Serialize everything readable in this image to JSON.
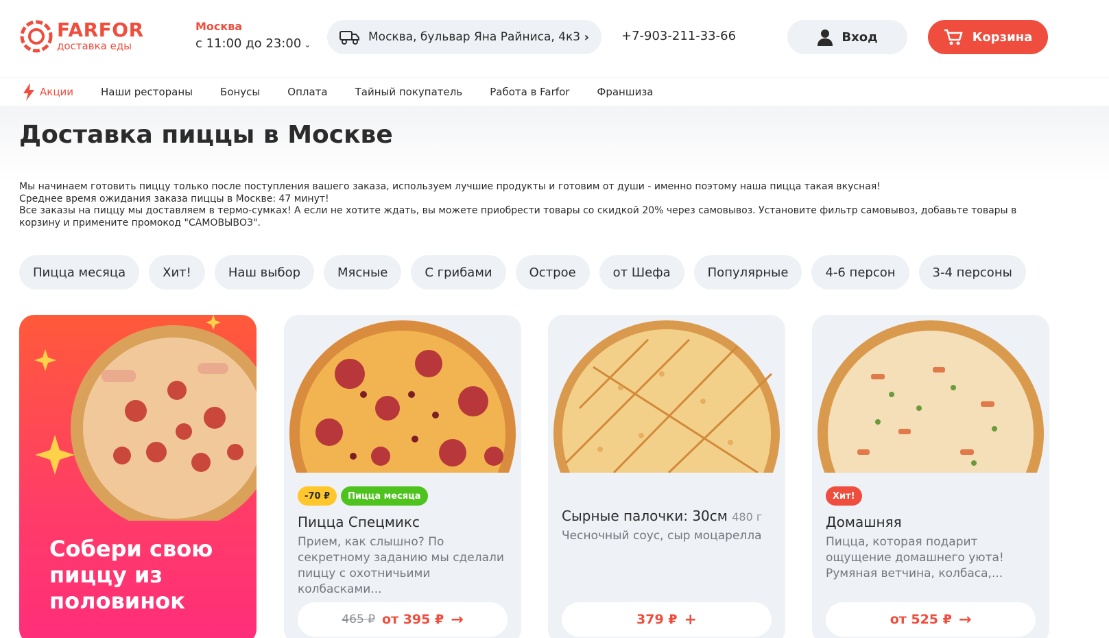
{
  "logo": {
    "brand": "FARFOR",
    "sub": "доставка еды"
  },
  "city": {
    "name": "Москва",
    "hours": "с 11:00 до 23:00"
  },
  "address": "Москва, бульвар Яна Райниса, 4к3",
  "phone": "+7-903-211-33-66",
  "login_label": "Вход",
  "cart_label": "Корзина",
  "nav": [
    "Акции",
    "Наши рестораны",
    "Бонусы",
    "Оплата",
    "Тайный покупатель",
    "Работа в Farfor",
    "Франшиза"
  ],
  "title": "Доставка пиццы в Москве",
  "description": [
    "Мы начинаем готовить пиццу только после поступления вашего заказа, используем лучшие продукты и готовим от души - именно поэтому наша пицца такая вкусная!",
    "Среднее время ожидания заказа пиццы в Москве: 47 минут!",
    "Все заказы на пиццу мы доставляем в термо-сумках! А если не хотите ждать, вы можете приобрести товары со скидкой 20% через самовывоз. Установите фильтр самовывоз, добавьте товары в корзину и примените промокод \"САМОВЫВОЗ\"."
  ],
  "filters": [
    "Пицца месяца",
    "Хит!",
    "Наш выбор",
    "Мясные",
    "С грибами",
    "Острое",
    "от Шефа",
    "Популярные",
    "4-6 персон",
    "3-4 персоны"
  ],
  "promo_card": {
    "text_lines": [
      "Собери свою",
      "пиццу из",
      "половинок"
    ]
  },
  "products": [
    {
      "badges": [
        "-70 ₽",
        "Пицца месяца"
      ],
      "name": "Пицца Спецмикс",
      "weight": "",
      "description": "Прием, как слышно? По секретному заданию мы сделали пиццу с охотничьими колбасками...",
      "old_price": "465 ₽",
      "price": "от 395 ₽"
    },
    {
      "badges": [],
      "name": "Сырные палочки: 30см",
      "weight": "480 г",
      "description": "Чесночный соус, сыр моцарелла",
      "old_price": "",
      "price": "379 ₽"
    },
    {
      "badges": [
        "Хит!"
      ],
      "name": "Домашняя",
      "weight": "",
      "description": "Пицца, которая подарит ощущение домашнего уюта! Румяная ветчина, колбаса,...",
      "old_price": "",
      "price": "от 525 ₽"
    }
  ],
  "colors": {
    "accent": "#ef4d3d",
    "chip_bg": "#eef1f6",
    "badge_green": "#4ec21d",
    "badge_yellow": "#ffc72c"
  }
}
